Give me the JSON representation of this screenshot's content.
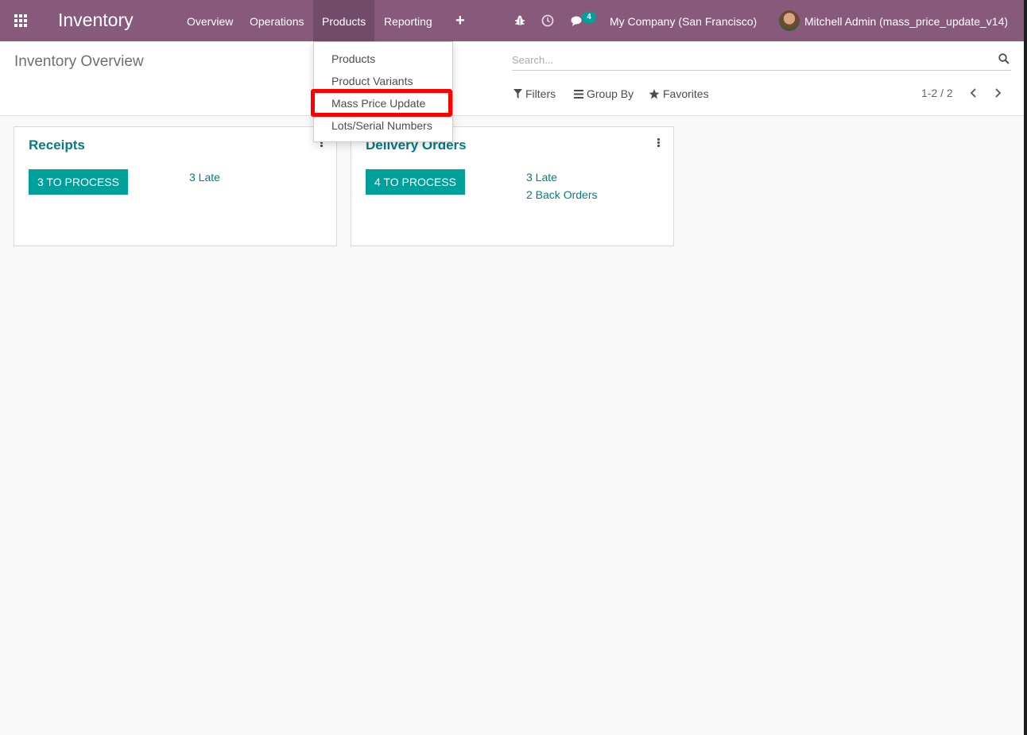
{
  "navbar": {
    "brand": "Inventory",
    "menu": [
      {
        "label": "Overview"
      },
      {
        "label": "Operations"
      },
      {
        "label": "Products"
      },
      {
        "label": "Reporting"
      }
    ],
    "plus_label": "+",
    "chat_badge": "4",
    "company": "My Company (San Francisco)",
    "user": "Mitchell Admin (mass_price_update_v14)",
    "icons": [
      "apps-grid-icon",
      "bug-icon",
      "clock-icon",
      "chat-icon"
    ]
  },
  "control": {
    "breadcrumb": "Inventory Overview",
    "search_placeholder": "Search...",
    "filters_label": "Filters",
    "group_by_label": "Group By",
    "favorites_label": "Favorites",
    "pager": "1-2 / 2"
  },
  "dropdown": {
    "items": [
      {
        "label": "Products"
      },
      {
        "label": "Product Variants"
      },
      {
        "label": "Mass Price Update"
      },
      {
        "label": "Lots/Serial Numbers"
      }
    ]
  },
  "cards": [
    {
      "title": "Receipts",
      "button": "3 TO PROCESS",
      "links": [
        "3 Late"
      ]
    },
    {
      "title": "Delivery Orders",
      "button": "4 TO PROCESS",
      "links": [
        "3 Late",
        "2 Back Orders"
      ]
    }
  ],
  "colors": {
    "navbar": "#875a7b",
    "accent": "#00a09d",
    "link": "#017e84",
    "highlight": "#ff0000"
  }
}
